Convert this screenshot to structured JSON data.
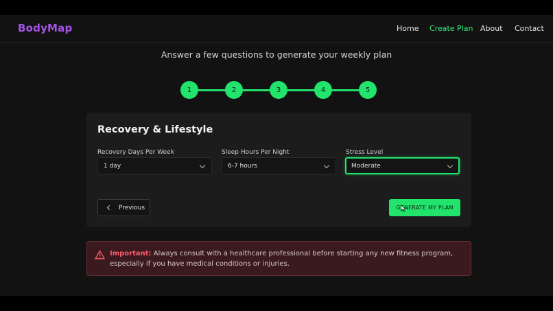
{
  "brand": {
    "name": "BodyMap"
  },
  "nav": {
    "home": "Home",
    "create_plan": "Create Plan",
    "about": "About",
    "contact": "Contact"
  },
  "header": {
    "subtitle": "Answer a few questions to generate your weekly plan"
  },
  "stepper": {
    "steps": [
      "1",
      "2",
      "3",
      "4",
      "5"
    ]
  },
  "form": {
    "title": "Recovery & Lifestyle",
    "recovery_days": {
      "label": "Recovery Days Per Week",
      "value": "1 day"
    },
    "sleep_hours": {
      "label": "Sleep Hours Per Night",
      "value": "6-7 hours"
    },
    "stress_level": {
      "label": "Stress Level",
      "value": "Moderate"
    },
    "previous_label": "Previous",
    "generate_label": "GENERATE MY PLAN"
  },
  "alert": {
    "strong": "Important:",
    "text": " Always consult with a healthcare professional before starting any new fitness program, especially if you have medical conditions or injuries."
  },
  "colors": {
    "accent": "#22e36b",
    "brand": "#a553e8",
    "alert_bg": "#3a1a1f",
    "alert_text": "#ff5a6e"
  },
  "icons": [
    "chevron-down-icon",
    "chevron-left-icon",
    "warning-icon",
    "mouse-cursor-icon"
  ]
}
